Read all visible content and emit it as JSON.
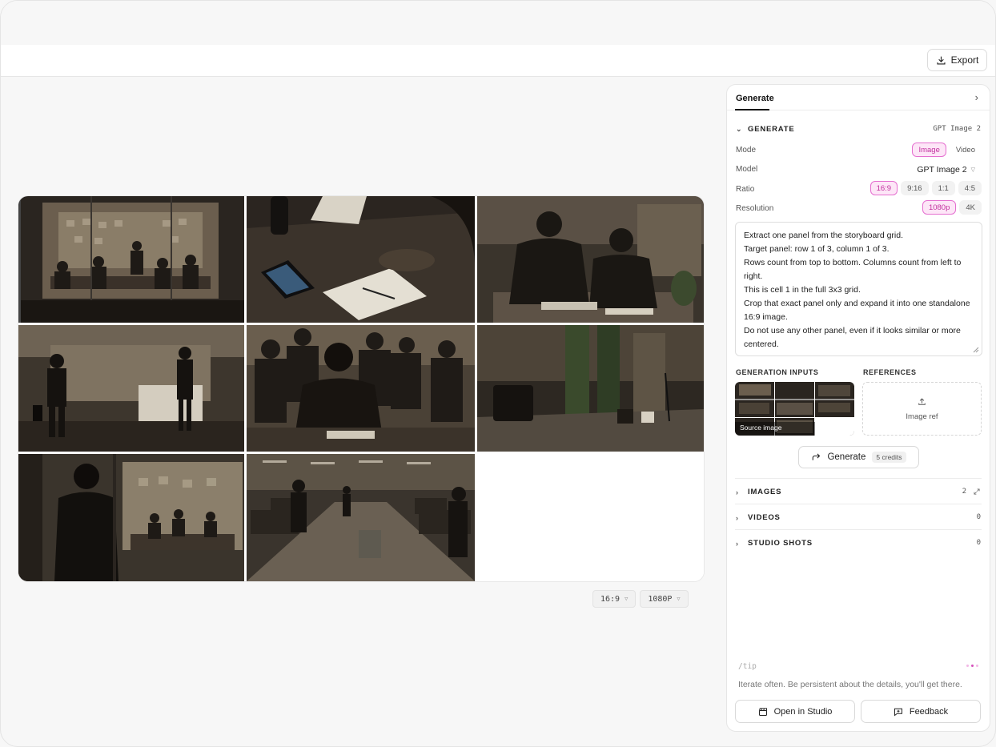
{
  "toolbar": {
    "export_label": "Export"
  },
  "canvas": {
    "ratio_chip": "16:9",
    "resolution_chip": "1080P"
  },
  "panel": {
    "tab_label": "Generate",
    "generate_section": {
      "title": "GENERATE",
      "model_badge": "GPT Image 2",
      "mode": {
        "label": "Mode",
        "options": [
          "Image",
          "Video"
        ],
        "selected": "Image"
      },
      "model": {
        "label": "Model",
        "value": "GPT Image 2"
      },
      "ratio": {
        "label": "Ratio",
        "options": [
          "16:9",
          "9:16",
          "1:1",
          "4:5"
        ],
        "selected": "16:9"
      },
      "resolution": {
        "label": "Resolution",
        "options": [
          "1080p",
          "4K"
        ],
        "selected": "1080p"
      },
      "prompt": "Extract one panel from the storyboard grid.\nTarget panel: row 1 of 3, column 1 of 3.\nRows count from top to bottom. Columns count from left to right.\nThis is cell 1 in the full 3x3 grid.\nCrop that exact panel only and expand it into one standalone 16:9 image.\nDo not use any other panel, even if it looks similar or more centered.",
      "generation_inputs_label": "GENERATION INPUTS",
      "references_label": "REFERENCES",
      "source_image_label": "Source image",
      "image_ref_label": "Image ref",
      "generate_button": "Generate",
      "credits": "5 credits"
    },
    "sections": [
      {
        "title": "IMAGES",
        "count": "2"
      },
      {
        "title": "VIDEOS",
        "count": "0"
      },
      {
        "title": "STUDIO SHOTS",
        "count": "0"
      }
    ],
    "tip": {
      "label": "/tip",
      "text": "Iterate often. Be persistent about the details, you'll get there."
    },
    "footer": {
      "open_studio": "Open in Studio",
      "feedback": "Feedback"
    }
  },
  "colors": {
    "accent": "#d651bb",
    "accent_bg": "#fde6f7"
  }
}
